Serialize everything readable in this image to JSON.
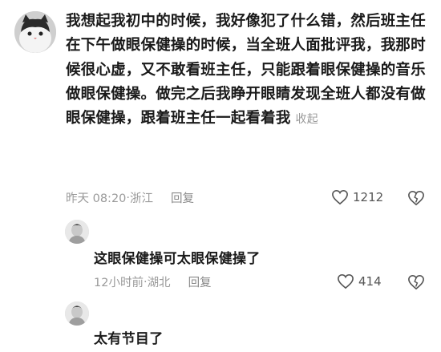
{
  "main_comment": {
    "text": "我想起我初中的时候，我好像犯了什么错，然后班主任在下午做眼保健操的时候，当全班人面批评我，我那时候很心虚，又不敢看班主任，只能跟着眼保健操的音乐做眼保健操。做完之后我睁开眼睛发现全班人都没有做眼保健操，跟着班主任一起看着我",
    "fold_label": "收起",
    "time": "昨天 08:20",
    "separator": "·",
    "location": "浙江",
    "reply_label": "回复",
    "likes": "1212",
    "like_icon": "heart-outline-icon",
    "dislike_icon": "broken-heart-icon"
  },
  "replies": [
    {
      "text": "这眼保健操可太眼保健操了",
      "time": "12小时前",
      "separator": "·",
      "location": "湖北",
      "reply_label": "回复",
      "likes": "414"
    },
    {
      "text": "太有节目了"
    }
  ],
  "colors": {
    "text": "#1a1a1a",
    "meta": "#9a9a9a",
    "background": "#ffffff"
  }
}
